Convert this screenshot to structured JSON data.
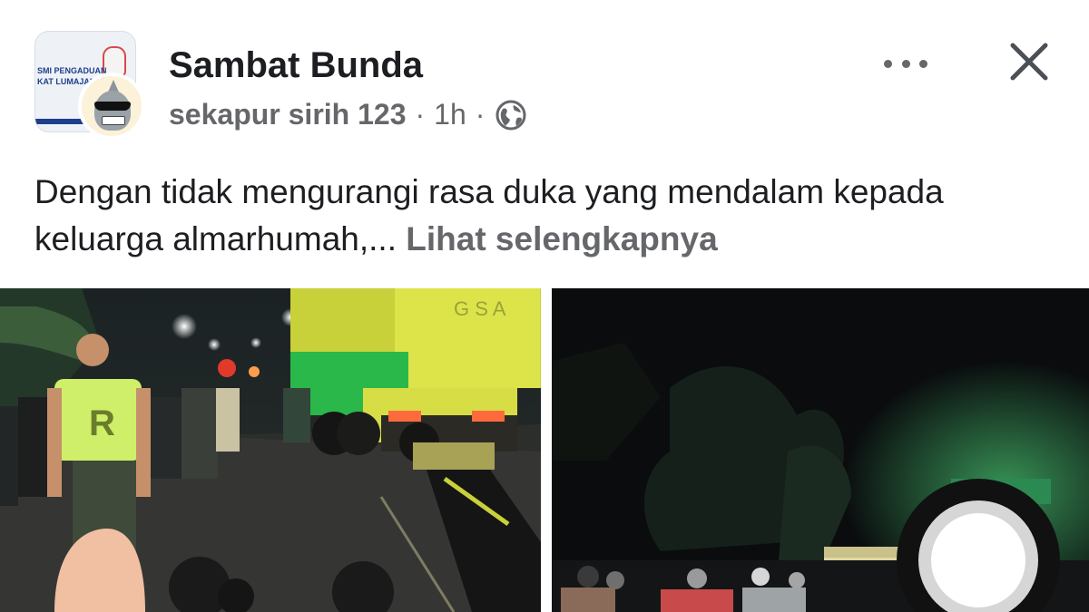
{
  "post": {
    "group_name": "Sambat Bunda",
    "author": "sekapur sirih 123",
    "separator": "·",
    "time": "1h",
    "privacy_icon": "globe-icon",
    "text": "Dengan tidak mengurangi rasa duka yang mendalam kepada keluarga almarhumah,...",
    "see_more": "Lihat selengkapnya"
  },
  "group_avatar": {
    "line1": "SMI PENGADUAN",
    "line2": "KAT LUMAJANG"
  },
  "icons": {
    "more": "more-options-icon",
    "close": "close-icon"
  },
  "photos": [
    {
      "name": "accident-scene-photo-left",
      "truck_lettering": "G S A",
      "shirt_letter": "R"
    },
    {
      "name": "accident-scene-photo-right"
    }
  ],
  "colors": {
    "text_primary": "#1c1e21",
    "text_secondary": "#65676b",
    "truck_yellow": "#d9e03a",
    "truck_green": "#2ebd4a"
  }
}
